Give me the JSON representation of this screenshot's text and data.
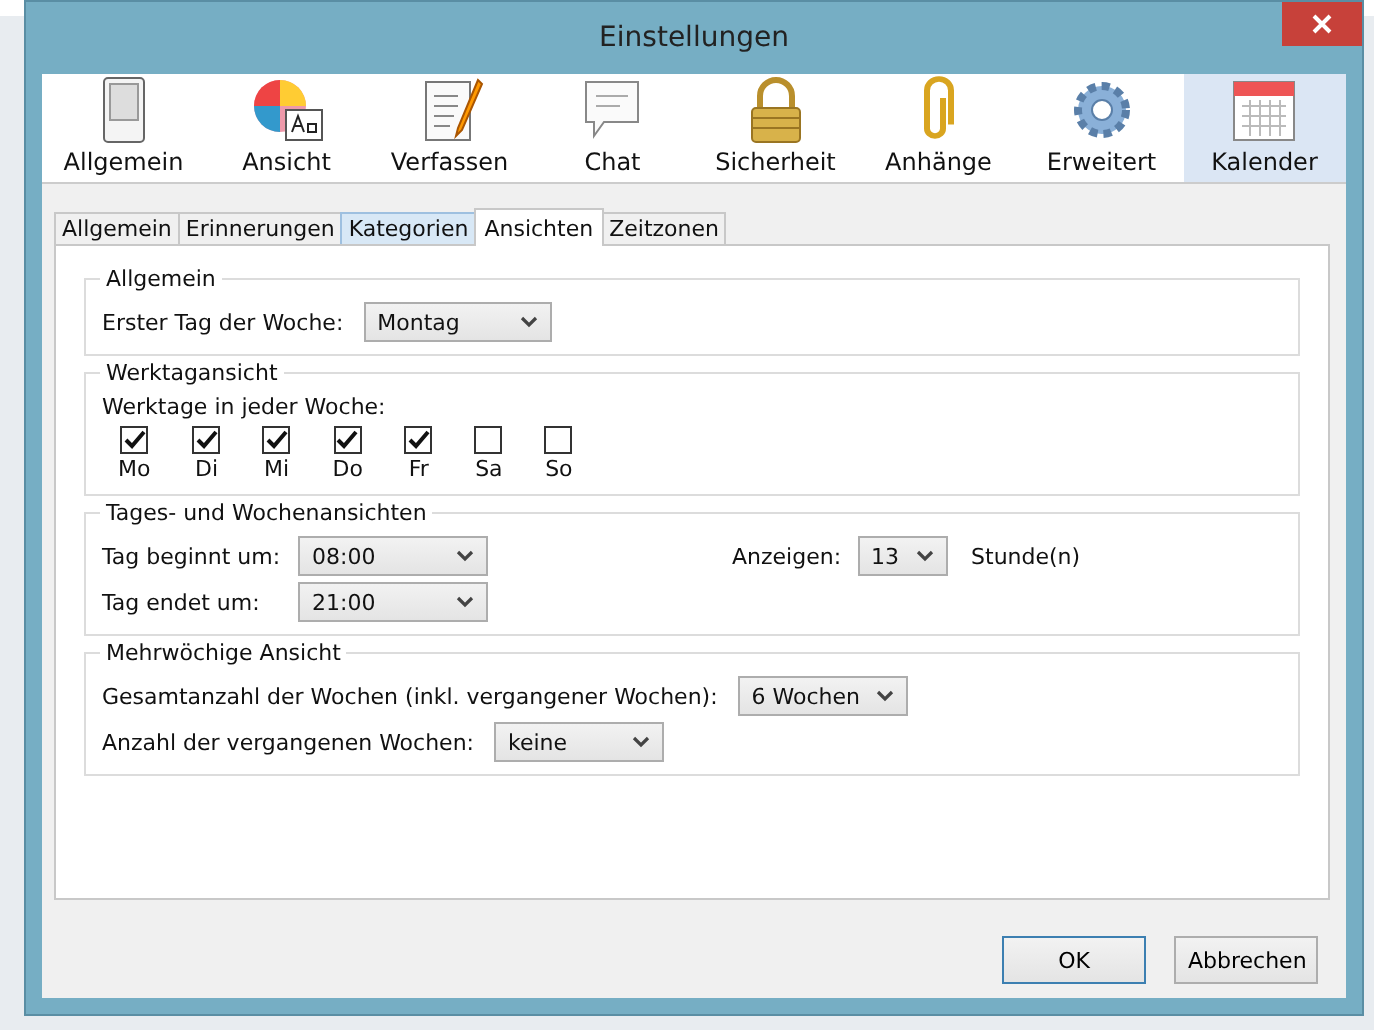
{
  "window": {
    "title": "Einstellungen"
  },
  "toolbar": [
    {
      "label": "Allgemein",
      "kind": "switch",
      "selected": false
    },
    {
      "label": "Ansicht",
      "kind": "palette",
      "selected": false
    },
    {
      "label": "Verfassen",
      "kind": "compose",
      "selected": false
    },
    {
      "label": "Chat",
      "kind": "chat",
      "selected": false
    },
    {
      "label": "Sicherheit",
      "kind": "lock",
      "selected": false
    },
    {
      "label": "Anhänge",
      "kind": "paperclip",
      "selected": false
    },
    {
      "label": "Erweitert",
      "kind": "gear",
      "selected": false
    },
    {
      "label": "Kalender",
      "kind": "calendar",
      "selected": true
    }
  ],
  "tabs": [
    {
      "label": "Allgemein",
      "selected": false,
      "highlighted": false
    },
    {
      "label": "Erinnerungen",
      "selected": false,
      "highlighted": false
    },
    {
      "label": "Kategorien",
      "selected": false,
      "highlighted": true
    },
    {
      "label": "Ansichten",
      "selected": true,
      "highlighted": false
    },
    {
      "label": "Zeitzonen",
      "selected": false,
      "highlighted": false
    }
  ],
  "general": {
    "title": "Allgemein",
    "first_day": {
      "label": "Erster Tag der Woche:",
      "value": "Montag"
    }
  },
  "workdays": {
    "title": "Werktagansicht",
    "label": "Werktage in jeder Woche:",
    "days": [
      {
        "label": "Mo",
        "checked": true
      },
      {
        "label": "Di",
        "checked": true
      },
      {
        "label": "Mi",
        "checked": true
      },
      {
        "label": "Do",
        "checked": true
      },
      {
        "label": "Fr",
        "checked": true
      },
      {
        "label": "Sa",
        "checked": false
      },
      {
        "label": "So",
        "checked": false
      }
    ]
  },
  "day_week": {
    "title": "Tages- und Wochenansichten",
    "start": {
      "label": "Tag beginnt um:",
      "value": "08:00"
    },
    "end": {
      "label": "Tag endet um:",
      "value": "21:00"
    },
    "show": {
      "label": "Anzeigen:",
      "value": "13",
      "unit": "Stunde(n)"
    }
  },
  "multiweek": {
    "title": "Mehrwöchige Ansicht",
    "total": {
      "label": "Gesamtanzahl der Wochen (inkl. vergangener Wochen):",
      "value": "6 Wochen"
    },
    "past": {
      "label": "Anzahl der vergangenen Wochen:",
      "value": "keine"
    }
  },
  "buttons": [
    {
      "label": "OK",
      "default": true
    },
    {
      "label": "Abbrechen",
      "default": false
    }
  ]
}
